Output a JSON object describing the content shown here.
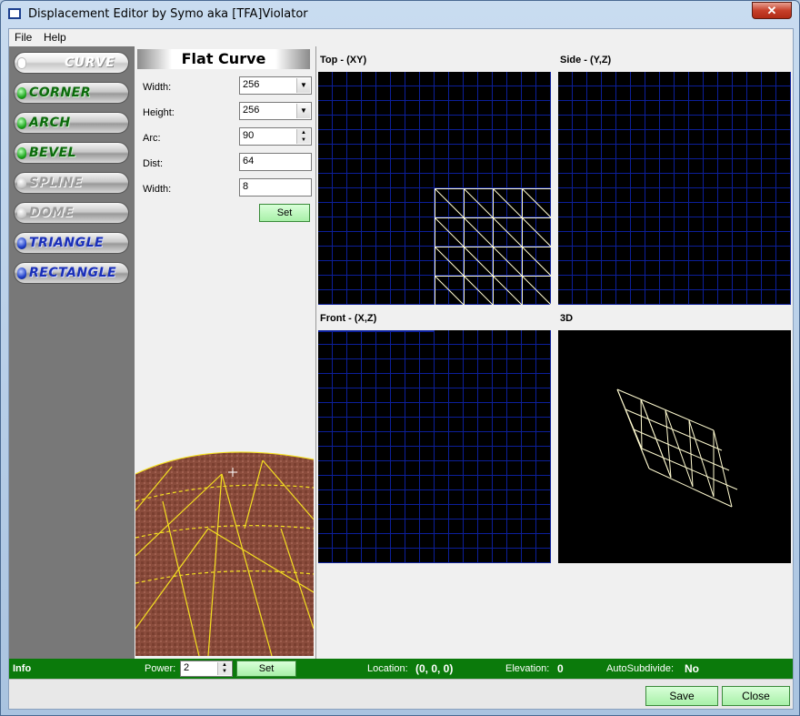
{
  "window": {
    "title": "Displacement Editor by Symo aka [TFA]Violator",
    "close_label": "✕"
  },
  "menu": {
    "items": [
      "File",
      "Help"
    ]
  },
  "tools": [
    {
      "label": "CURVE",
      "state": "selected"
    },
    {
      "label": "CORNER",
      "state": "green"
    },
    {
      "label": "ARCH",
      "state": "green"
    },
    {
      "label": "BEVEL",
      "state": "green"
    },
    {
      "label": "SPLINE",
      "state": "disabled"
    },
    {
      "label": "DOME",
      "state": "disabled"
    },
    {
      "label": "TRIANGLE",
      "state": "blue"
    },
    {
      "label": "RECTANGLE",
      "state": "blue"
    }
  ],
  "props": {
    "title": "Flat Curve",
    "width_label": "Width:",
    "width_value": "256",
    "height_label": "Height:",
    "height_value": "256",
    "arc_label": "Arc:",
    "arc_value": "90",
    "dist_label": "Dist:",
    "dist_value": "64",
    "width2_label": "Width:",
    "width2_value": "8",
    "set_label": "Set"
  },
  "viewports": {
    "top": "Top - (XY)",
    "side": "Side - (Y,Z)",
    "front": "Front - (X,Z)",
    "three_d": "3D"
  },
  "info": {
    "title": "Info",
    "power_label": "Power:",
    "power_value": "2",
    "set_label": "Set",
    "location_label": "Location:",
    "location_value": "(0, 0, 0)",
    "elevation_label": "Elevation:",
    "elevation_value": "0",
    "autosubdivide_label": "AutoSubdivide:",
    "autosubdivide_value": "No"
  },
  "footer": {
    "save_label": "Save",
    "close_label": "Close"
  },
  "colors": {
    "info_bar": "#0b7a0b",
    "grid": "#0c1f9a",
    "mesh": "#fffbd0",
    "tool_panel": "#787878"
  }
}
